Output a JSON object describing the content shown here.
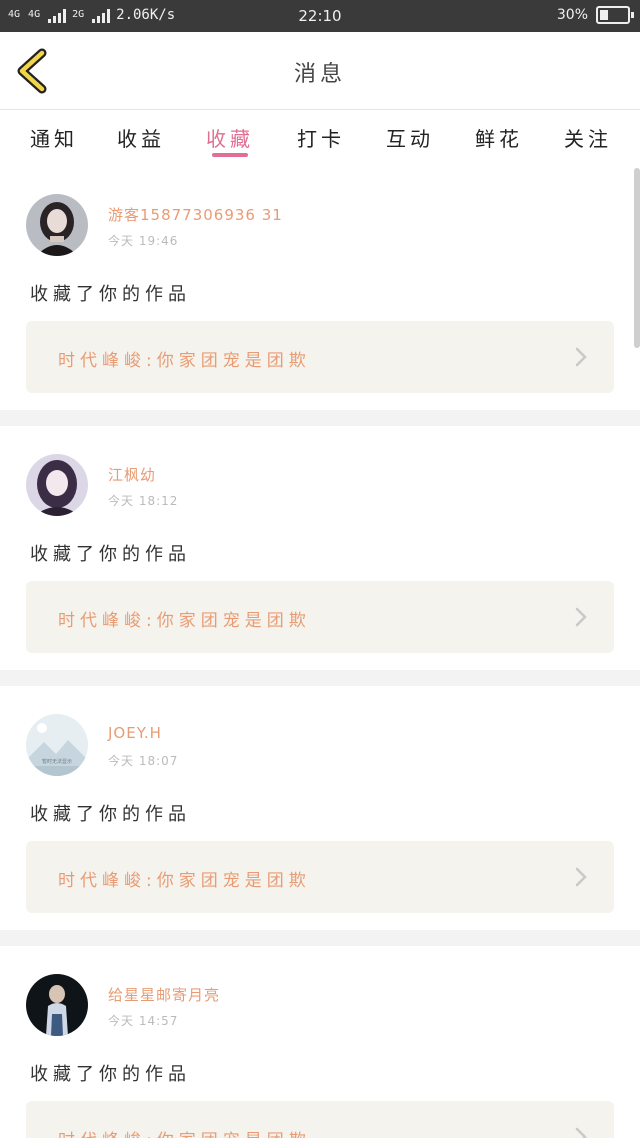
{
  "status_bar": {
    "network_1": "4G",
    "network_2": "4G",
    "network_3": "2G",
    "speed": "2.06K/s",
    "time": "22:10",
    "battery": "30%",
    "battery_level": 0.3
  },
  "header": {
    "title": "消息",
    "back_icon": "chevron-left-icon"
  },
  "tabs": [
    {
      "label": "通知",
      "active": false
    },
    {
      "label": "收益",
      "active": false
    },
    {
      "label": "收藏",
      "active": true
    },
    {
      "label": "打卡",
      "active": false
    },
    {
      "label": "互动",
      "active": false
    },
    {
      "label": "鲜花",
      "active": false
    },
    {
      "label": "关注",
      "active": false
    }
  ],
  "colors": {
    "accent": "#e06f93",
    "name": "#e99c74",
    "card_bg": "#f4f3ee"
  },
  "messages": [
    {
      "name": "游客15877306936 31",
      "time": "今天 19:46",
      "action": "收藏了你的作品",
      "work": "时代峰峻:你家团宠是团欺",
      "avatar": "dark-girl-avatar"
    },
    {
      "name": "江枫幼",
      "time": "今天 18:12",
      "action": "收藏了你的作品",
      "work": "时代峰峻:你家团宠是团欺",
      "avatar": "purple-girl-avatar"
    },
    {
      "name": "JOEY.H",
      "time": "今天 18:07",
      "action": "收藏了你的作品",
      "work": "时代峰峻:你家团宠是团欺",
      "avatar": "landscape-avatar",
      "avatar_caption": "暂时无法显示"
    },
    {
      "name": "给星星邮寄月亮",
      "time": "今天 14:57",
      "action": "收藏了你的作品",
      "work": "时代峰峻:你家团宠是团欺",
      "avatar": "boy-avatar"
    }
  ]
}
